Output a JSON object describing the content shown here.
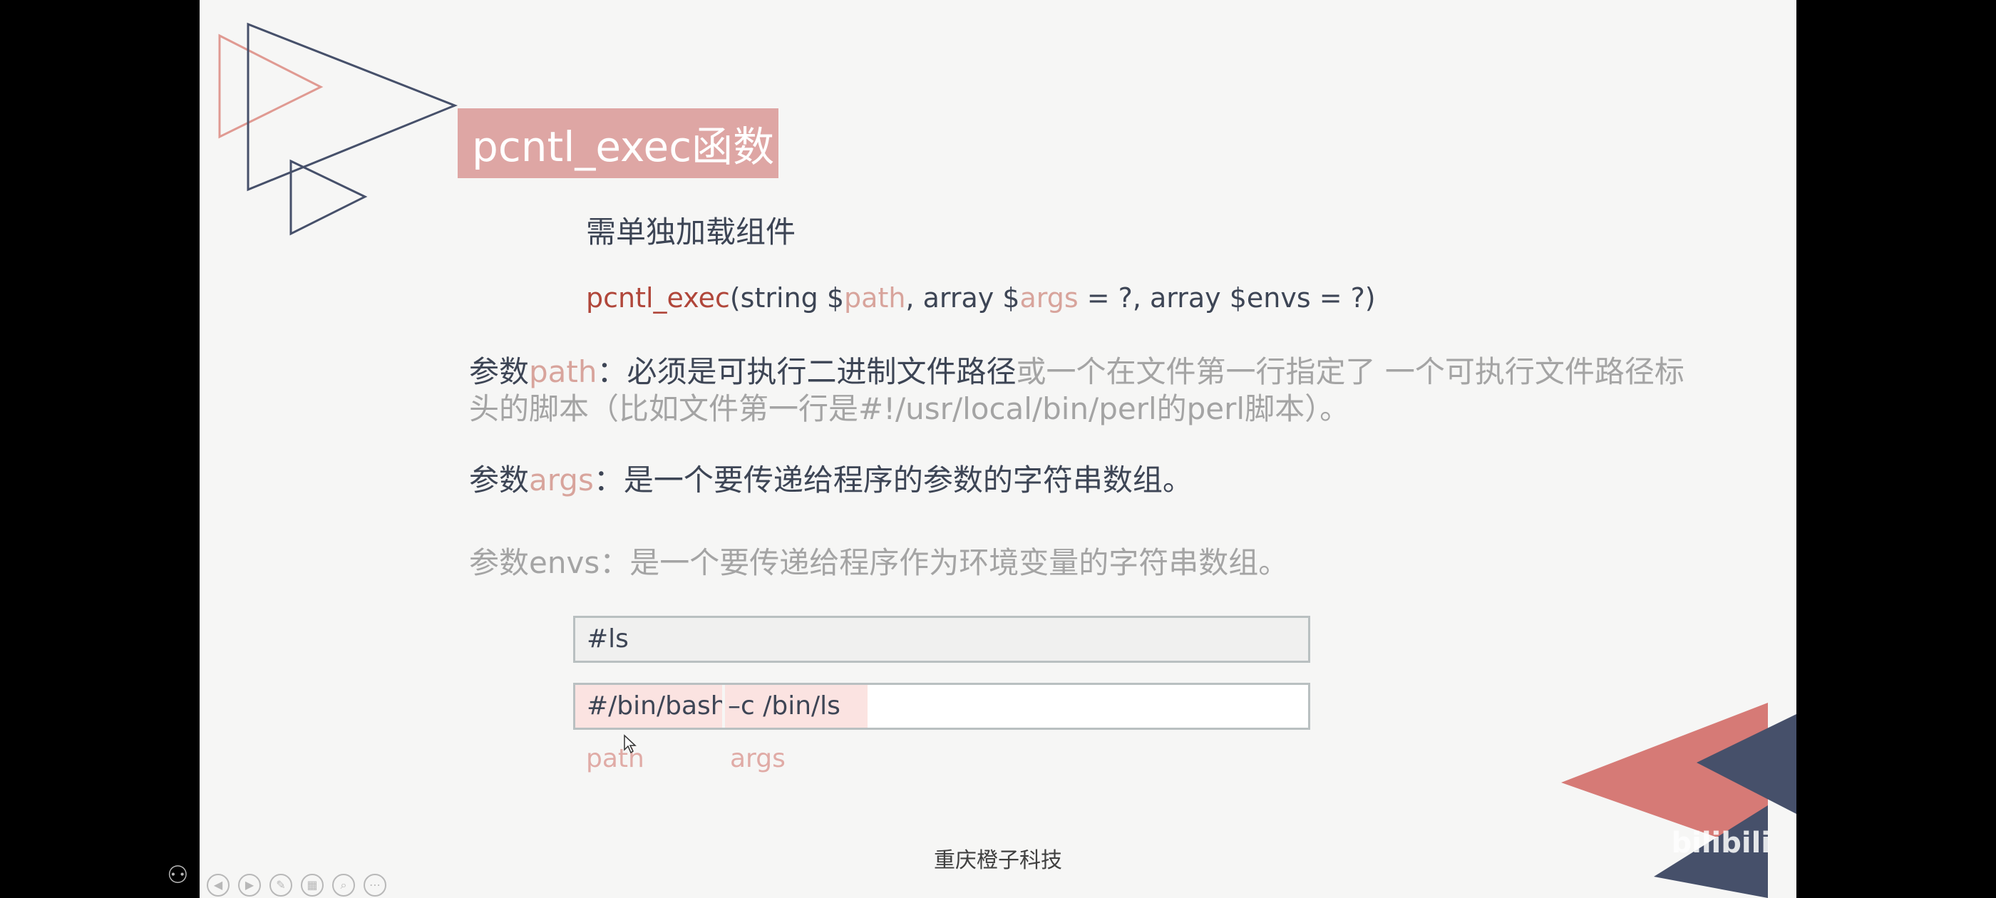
{
  "slide": {
    "title": "pcntl_exec函数",
    "subtitle": "需单独加载组件",
    "signature": {
      "fn": "pcntl_exec",
      "p1": "(string $",
      "path": "path",
      "p2": ", array $",
      "args": "args",
      "p3": " = ?, array $envs = ?)"
    },
    "param_path": {
      "prefix": "参数",
      "name": "path",
      "sep": "：",
      "bold": "必须是可执行二进制文件路径",
      "rest": "或一个在文件第一行指定了 一个可执行文件路径标",
      "line2": "头的脚本（比如文件第一行是#!/usr/local/bin/perl的perl脚本）。"
    },
    "param_args": {
      "prefix": "参数",
      "name": "args",
      "text": "：是一个要传递给程序的参数的字符串数组。"
    },
    "param_envs": {
      "text": "参数envs：是一个要传递给程序作为环境变量的字符串数组。"
    },
    "example1": "#ls",
    "example2": {
      "path_part": "#/bin/bash",
      "args_part": "–c /bin/ls"
    },
    "label_path": "path",
    "label_args": "args",
    "footer": "重庆橙子科技"
  },
  "toolbar": {
    "icons": [
      "people-icon",
      "prev-icon",
      "next-icon",
      "pen-icon",
      "slides-icon",
      "zoom-icon",
      "more-icon"
    ]
  },
  "watermark": "bilibili",
  "colors": {
    "accent_pink": "#dea6a4",
    "accent_red": "#b0463a",
    "navy": "#3d4555",
    "triangle_red": "#d67a76",
    "triangle_navy": "#46506a"
  }
}
